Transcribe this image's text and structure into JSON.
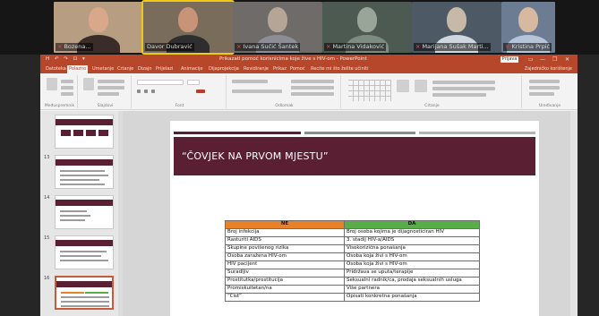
{
  "participants": [
    {
      "name": "Bozena...",
      "muted": true,
      "bg": "#b79e82",
      "shirt": "#3a2c28"
    },
    {
      "name": "Davor Dubravić",
      "muted": false,
      "bg": "#7a6c5a",
      "shirt": "#2e2e30"
    },
    {
      "name": "Ivana Sučić Šantek",
      "muted": true,
      "bg": "#6e6b68",
      "shirt": "#8b8f95"
    },
    {
      "name": "Martina Vidaković",
      "muted": true,
      "bg": "#4c5a51",
      "shirt": "#7c8c80"
    },
    {
      "name": "Marijana Sušak Marti...",
      "muted": true,
      "bg": "#4d5964",
      "shirt": "#cfd6dd"
    },
    {
      "name": "Kristina Prpić",
      "muted": true,
      "bg": "#6c7c92",
      "shirt": "#b6c4d8"
    }
  ],
  "window": {
    "qat": "H ↶ ↷ ⊡ ▾",
    "title": "Prikazati pomoć korisnicima koje žive s HIV-om - PowerPoint",
    "sign_in": "Prijava",
    "controls": [
      "▭",
      "—",
      "❐",
      "✕"
    ]
  },
  "tabs": [
    {
      "label": "Datoteka"
    },
    {
      "label": "Polazno"
    },
    {
      "label": "Umetanje"
    },
    {
      "label": "Crtanje"
    },
    {
      "label": "Dizajn"
    },
    {
      "label": "Prijelazi"
    },
    {
      "label": "Animacije"
    },
    {
      "label": "Dijaprojekcija"
    },
    {
      "label": "Revidiranje"
    },
    {
      "label": "Prikaz"
    },
    {
      "label": "Pomoć"
    },
    {
      "label": "Recite mi što želite učiniti"
    }
  ],
  "share": "Zajedničko korištenje",
  "ribbon_groups": [
    "Međuspremnik",
    "Slajdovi",
    "Font",
    "Odlomak",
    "Crtanje",
    "Uređivanje"
  ],
  "slides_pane": {
    "numbers": [
      "",
      "13",
      "14",
      "15",
      "16",
      "17"
    ]
  },
  "slide": {
    "title": "“ČOVJEK NA PRVOM MJESTU”",
    "table": {
      "headers": [
        "NE",
        "DA"
      ],
      "rows": [
        [
          "Broj infekcija",
          "Broj osoba kojima je dijagnosticiran HIV"
        ],
        [
          "Rasturiti AIDS",
          "3. stadij HIV-a/AIDS"
        ],
        [
          "Skupine povišenog rizika",
          "Visokorizična ponašanja"
        ],
        [
          "Osoba zaražena HIV-om",
          "Osoba koja živi s HIV-om"
        ],
        [
          "HIV pacijent",
          "Osoba koja živi s HIV-om"
        ],
        [
          "Suradljiv",
          "Pridržava se uputa/terapije"
        ],
        [
          "Prostitutka/prostitucija",
          "Seksualni radnik/ca, prodaja seksualnih usluga"
        ],
        [
          "Promiskuitetan/na",
          "Više partnera"
        ],
        [
          "“Čist”",
          "Opisati konkretna ponašanja"
        ]
      ]
    }
  }
}
